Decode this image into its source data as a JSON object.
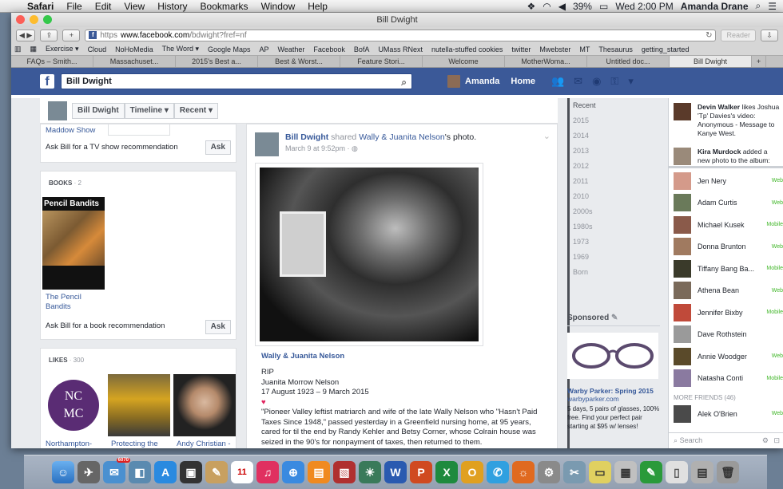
{
  "menubar": {
    "app": "Safari",
    "items": [
      "File",
      "Edit",
      "View",
      "History",
      "Bookmarks",
      "Window",
      "Help"
    ],
    "battery": "39%",
    "clock": "Wed 2:00 PM",
    "user": "Amanda Drane"
  },
  "window": {
    "title": "Bill Dwight"
  },
  "browser": {
    "url_https": "https",
    "url_domain": "www.facebook.com",
    "url_path": "/bdwight?fref=nf",
    "reader": "Reader",
    "bookmarks": [
      "Exercise ▾",
      "Cloud",
      "NoHoMedia",
      "The Word ▾",
      "Google Maps",
      "AP",
      "Weather",
      "Facebook",
      "BofA",
      "UMass RNext",
      "nutella-stuffed cookies",
      "twitter",
      "Mwebster",
      "MT",
      "Thesaurus",
      "getting_started"
    ],
    "tabs": [
      "FAQs – Smith...",
      "Massachuset...",
      "2015's Best a...",
      "Best & Worst...",
      "Feature Stori...",
      "Welcome",
      "MotherWoma...",
      "Untitled doc...",
      "Bill Dwight"
    ],
    "tab_plus": "+"
  },
  "fb": {
    "search_value": "Bill Dwight",
    "user": "Amanda",
    "home": "Home"
  },
  "profile_bar": {
    "name_btn": "Bill Dwight",
    "timeline_btn": "Timeline ▾",
    "recent_btn": "Recent ▾"
  },
  "left": {
    "tv_show": "Maddow Show",
    "tv_ask": "Ask Bill for a TV show recommendation",
    "ask": "Ask",
    "books_title": "BOOKS",
    "books_count": "· 2",
    "book_cover_text": "Pencil Bandits",
    "book_name": "The Pencil Bandits",
    "book_ask": "Ask Bill for a book recommendation",
    "likes_title": "LIKES",
    "likes_count": "· 300",
    "likes": [
      "Northampton-",
      "Protecting the",
      "Andy Christian -"
    ],
    "ncmc": "NC MC"
  },
  "post": {
    "author": "Bill Dwight",
    "shared": " shared ",
    "target": "Wally & Juanita Nelson",
    "suffix": "'s photo.",
    "time": "March 9 at 9:52pm · ◍",
    "source": "Wally & Juanita Nelson",
    "rip": "RIP",
    "name": "Juanita Morrow Nelson",
    "dates": "17 August 1923 – 9 March 2015",
    "heart": "♥",
    "body": "\"Pioneer Valley leftist matriarch and wife of the late Wally Nelson who \"Hasn't Paid Taxes Since 1948,\" passed yesterday in a Greenfield nursing home, at 95 years, cared for til the end by Randy Kehler and Betsy Corner, whose Colrain house was seized in the 90's for nonpayment of taxes, then returned to them."
  },
  "timeline": [
    "Recent",
    "2015",
    "2014",
    "2013",
    "2012",
    "2011",
    "2010",
    "2000s",
    "1980s",
    "1973",
    "1969",
    "Born"
  ],
  "sponsored": {
    "title": "Sponsored",
    "ad_title": "Warby Parker: Spring 2015",
    "ad_url": "warbyparker.com",
    "ad_text": "5 days, 5 pairs of glasses, 100% free. Find your perfect pair starting at $95 w/ lenses!"
  },
  "ticker": [
    {
      "name": "Devin Walker",
      "text": " likes Joshua 'Tp' Davies's video: Anonymous - Message to Kanye West."
    },
    {
      "name": "Kira Murdock",
      "text": " added a new photo to the album: Winter"
    }
  ],
  "chat": {
    "friends": [
      {
        "name": "Jen Nery",
        "status": "Web"
      },
      {
        "name": "Adam Curtis",
        "status": "Web"
      },
      {
        "name": "Michael Kusek",
        "status": "Mobile"
      },
      {
        "name": "Donna Brunton",
        "status": "Web"
      },
      {
        "name": "Tiffany Bang Ba...",
        "status": "Mobile"
      },
      {
        "name": "Athena Bean",
        "status": "Web"
      },
      {
        "name": "Jennifer Bixby",
        "status": "Mobile"
      },
      {
        "name": "Dave Rothstein",
        "status": ""
      },
      {
        "name": "Annie Woodger",
        "status": "Web"
      },
      {
        "name": "Natasha Conti",
        "status": "Mobile"
      }
    ],
    "more_friends": "MORE FRIENDS (46)",
    "more": [
      {
        "name": "Alek O'Brien",
        "status": "Web"
      }
    ],
    "search": "Search"
  },
  "dock_badge": "6070",
  "calendar_day": "11"
}
